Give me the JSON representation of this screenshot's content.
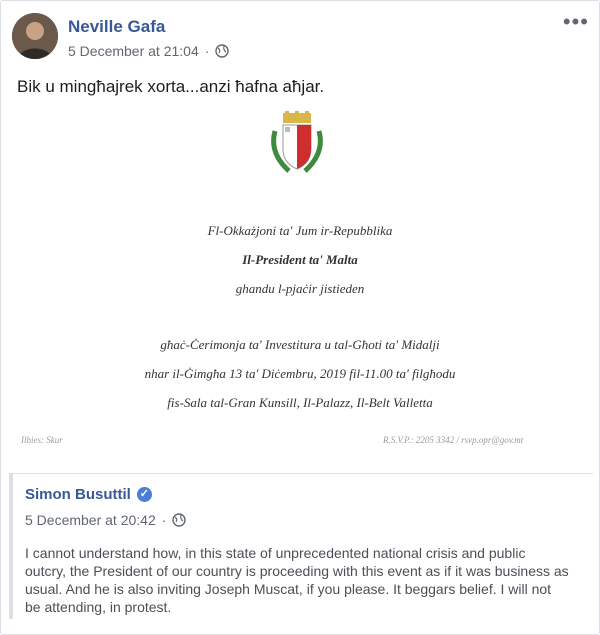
{
  "post": {
    "author": "Neville Gafa",
    "timestamp": "5 December at 21:04",
    "privacy_icon": "globe-icon",
    "text": "Bik u mingħajrek xorta...anzi ħafna aħjar.",
    "more_label": "•••"
  },
  "invitation": {
    "line1": "Fl-Okkażjoni ta' Jum ir-Repubblika",
    "line2": "Il-President ta' Malta",
    "line3": "ghandu l-pjaċir jistieden",
    "line4": "għaċ-Ċerimonja ta' Investitura u tal-Għoti ta' Midalji",
    "line5": "nhar il-Ġimgħa 13 ta' Diċembru, 2019 fil-11.00 ta' filgħodu",
    "line6": "fis-Sala tal-Gran Kunsill, Il-Palazz, Il-Belt Valletta",
    "footer_left": "Ilbies: Skur",
    "footer_right": "R.S.V.P.: 2205 3342 / rsvp.opr@gov.mt"
  },
  "shared_post": {
    "author": "Simon Busuttil",
    "verified_icon": "verified-badge-icon",
    "timestamp": "5 December at 20:42",
    "text": "I cannot understand how, in this state of unprecedented national crisis and public outcry, the President of our country is proceeding with this event as if it was business as usual. And he is also inviting Joseph Muscat, if you please. It beggars belief. I will not be attending, in protest."
  },
  "colors": {
    "link": "#385898",
    "meta": "#616770",
    "text": "#1c1e21",
    "verified": "#4b7ed6"
  }
}
